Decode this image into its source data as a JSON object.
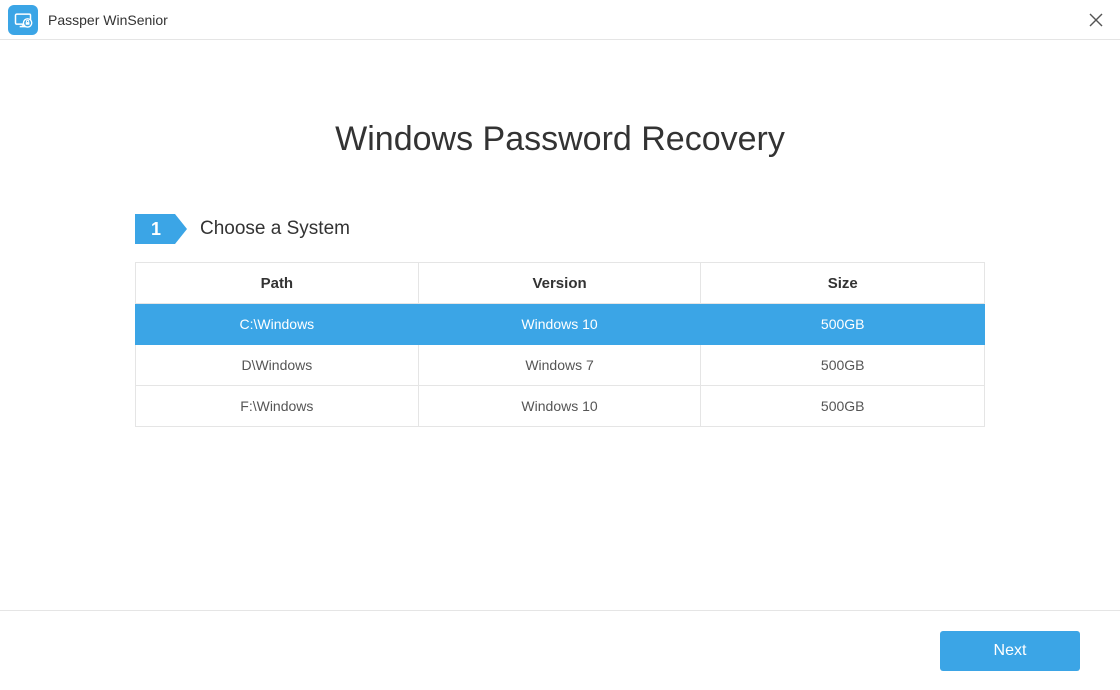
{
  "titlebar": {
    "app_name": "Passper WinSenior"
  },
  "page": {
    "title": "Windows Password Recovery"
  },
  "step": {
    "number": "1",
    "label": "Choose a System"
  },
  "table": {
    "headers": {
      "path": "Path",
      "version": "Version",
      "size": "Size"
    },
    "rows": [
      {
        "path": "C:\\Windows",
        "version": "Windows 10",
        "size": "500GB",
        "selected": true
      },
      {
        "path": "D\\Windows",
        "version": "Windows 7",
        "size": "500GB",
        "selected": false
      },
      {
        "path": "F:\\Windows",
        "version": "Windows 10",
        "size": "500GB",
        "selected": false
      }
    ]
  },
  "footer": {
    "next_label": "Next"
  },
  "colors": {
    "accent": "#3ba5e6"
  }
}
